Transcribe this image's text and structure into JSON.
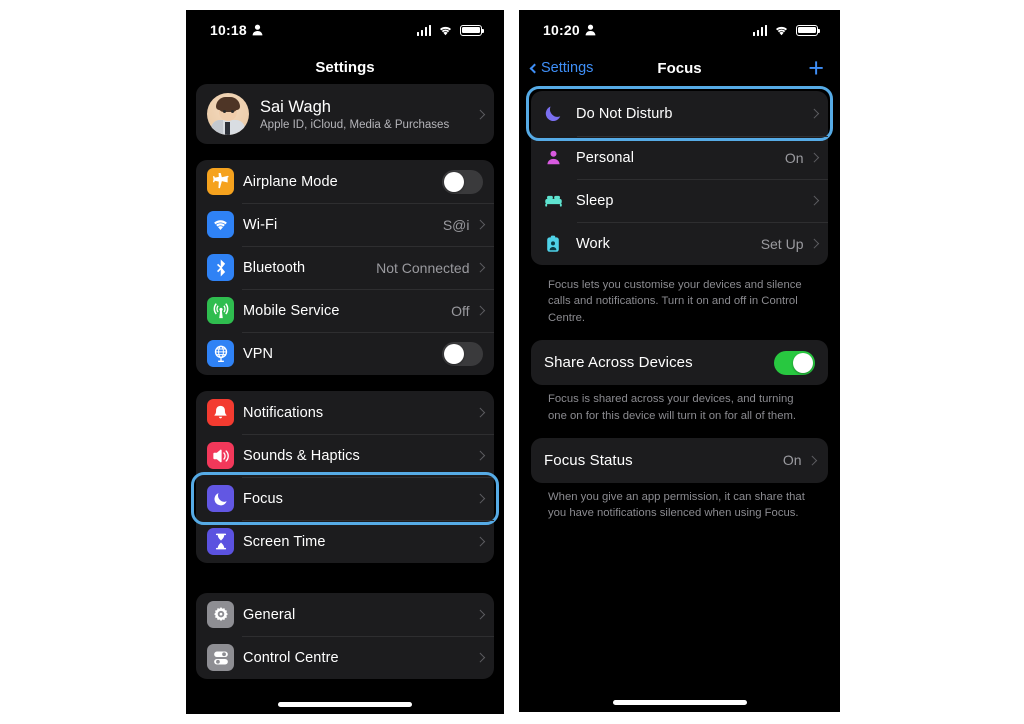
{
  "theme": {
    "accent_blue": "#3f8ff7",
    "highlight_ring": "#56abe6",
    "toggle_on_green": "#28c840",
    "group_bg": "#1c1c1e",
    "page_bg": "#000000"
  },
  "left_phone": {
    "status": {
      "time": "10:18",
      "person_icon": "person-icon",
      "signal_icon": "cellular-bars-icon",
      "wifi_icon": "wifi-icon",
      "battery_icon": "battery-icon"
    },
    "nav": {
      "title": "Settings"
    },
    "account": {
      "name": "Sai Wagh",
      "subtitle": "Apple ID, iCloud, Media & Purchases",
      "avatar_name": "memoji-avatar"
    },
    "groups": [
      {
        "name": "connectivity-group",
        "rows": [
          {
            "label": "Airplane Mode",
            "icon": "airplane-icon",
            "icon_color": "#f5a21e",
            "control": "toggle",
            "toggle_on": false
          },
          {
            "label": "Wi-Fi",
            "icon": "wifi-icon",
            "icon_color": "#2f82f5",
            "value": "S@i",
            "control": "chevron"
          },
          {
            "label": "Bluetooth",
            "icon": "bluetooth-icon",
            "icon_color": "#2f82f5",
            "value": "Not Connected",
            "control": "chevron"
          },
          {
            "label": "Mobile Service",
            "icon": "cellular-antenna-icon",
            "icon_color": "#2fbd4f",
            "value": "Off",
            "control": "chevron"
          },
          {
            "label": "VPN",
            "icon": "vpn-globe-icon",
            "icon_color": "#2f82f5",
            "control": "toggle",
            "toggle_on": false
          }
        ]
      },
      {
        "name": "notifications-group",
        "rows": [
          {
            "label": "Notifications",
            "icon": "bell-icon",
            "icon_color": "#f33b30",
            "control": "chevron"
          },
          {
            "label": "Sounds & Haptics",
            "icon": "speaker-icon",
            "icon_color": "#f2385a",
            "control": "chevron"
          },
          {
            "label": "Focus",
            "icon": "moon-icon",
            "icon_color": "#6257e3",
            "control": "chevron",
            "highlighted": true
          },
          {
            "label": "Screen Time",
            "icon": "hourglass-icon",
            "icon_color": "#5b52e0",
            "control": "chevron"
          }
        ]
      },
      {
        "name": "system-group",
        "rows": [
          {
            "label": "General",
            "icon": "gear-icon",
            "icon_color": "#8e8e93",
            "control": "chevron"
          },
          {
            "label": "Control Centre",
            "icon": "sliders-icon",
            "icon_color": "#8e8e93",
            "control": "chevron"
          }
        ]
      }
    ]
  },
  "right_phone": {
    "status": {
      "time": "10:20",
      "person_icon": "person-icon",
      "signal_icon": "cellular-bars-icon",
      "wifi_icon": "wifi-icon",
      "battery_icon": "battery-icon"
    },
    "nav": {
      "back_label": "Settings",
      "title": "Focus",
      "add_label": "+"
    },
    "focus_rows": [
      {
        "label": "Do Not Disturb",
        "icon": "moon-icon",
        "icon_color": "#7a6ff0",
        "value": "",
        "highlighted": true
      },
      {
        "label": "Personal",
        "icon": "person-focus-icon",
        "icon_color": "#d85ae0",
        "value": "On"
      },
      {
        "label": "Sleep",
        "icon": "bed-icon",
        "icon_color": "#5ee3d0",
        "value": ""
      },
      {
        "label": "Work",
        "icon": "badge-icon",
        "icon_color": "#4fd2e8",
        "value": "Set Up"
      }
    ],
    "focus_footnote": "Focus lets you customise your devices and silence calls and notifications. Turn it on and off in Control Centre.",
    "share_row": {
      "label": "Share Across Devices",
      "toggle_on": true
    },
    "share_footnote": "Focus is shared across your devices, and turning one on for this device will turn it on for all of them.",
    "status_row": {
      "label": "Focus Status",
      "value": "On"
    },
    "status_footnote": "When you give an app permission, it can share that you have notifications silenced when using Focus."
  }
}
